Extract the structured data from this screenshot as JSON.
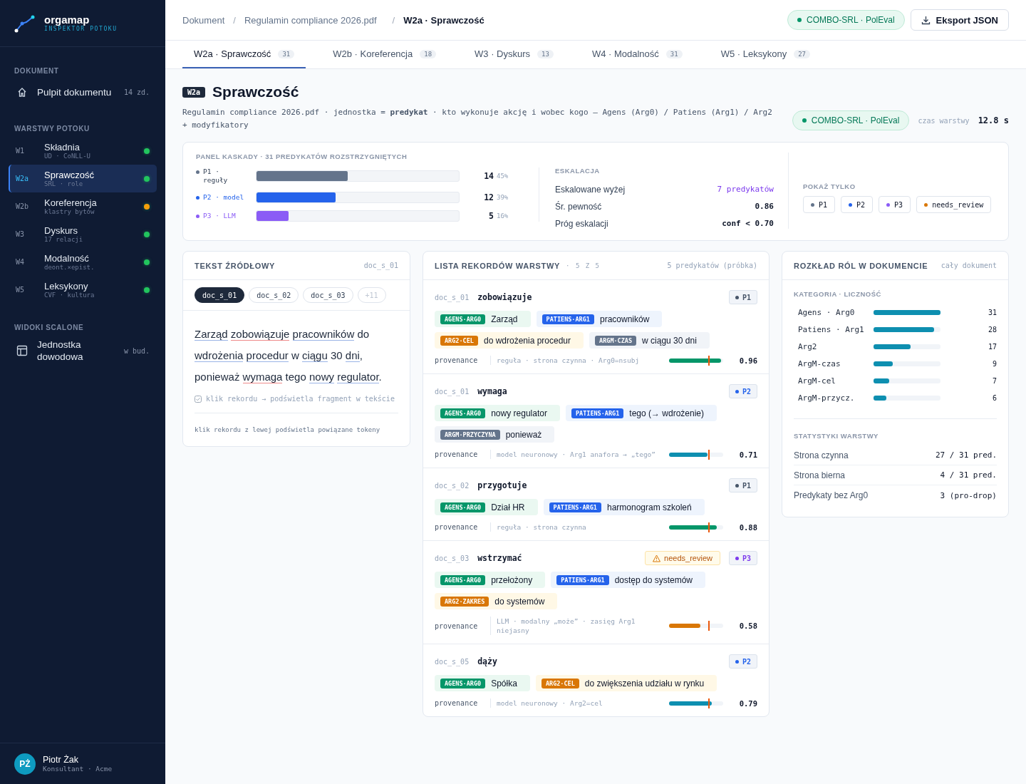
{
  "sidebar": {
    "logo": {
      "name": "orgamap",
      "tagline": "INSPEKTOR POTOKU"
    },
    "sections": [
      {
        "heading": "DOKUMENT",
        "items": [
          {
            "kind": "dashboard",
            "label": "Pulpit dokumentu",
            "meta": "14 zd.",
            "selected": false
          }
        ]
      },
      {
        "heading": "WARSTWY POTOKU",
        "items": [
          {
            "kind": "layer",
            "code": "W1",
            "label": "Składnia",
            "sub": "UD · CoNLL-U",
            "color": "#22c55e",
            "selected": false
          },
          {
            "kind": "layer",
            "code": "W2a",
            "label": "Sprawczość",
            "sub": "SRL · role",
            "color": "#22c55e",
            "selected": true
          },
          {
            "kind": "layer",
            "code": "W2b",
            "label": "Koreferencja",
            "sub": "klastry bytów",
            "color": "#f59e0b",
            "selected": false
          },
          {
            "kind": "layer",
            "code": "W3",
            "label": "Dyskurs",
            "sub": "17 relacji",
            "color": "#22c55e",
            "selected": false
          },
          {
            "kind": "layer",
            "code": "W4",
            "label": "Modalność",
            "sub": "deont.×epist.",
            "color": "#22c55e",
            "selected": false
          },
          {
            "kind": "layer",
            "code": "W5",
            "label": "Leksykony",
            "sub": "CVF · kultura",
            "color": "#22c55e",
            "selected": false
          }
        ]
      },
      {
        "heading": "WIDOKI SCALONE",
        "items": [
          {
            "kind": "view",
            "label": "Jednostka dowodowa",
            "meta": "w bud.",
            "selected": false
          }
        ]
      }
    ],
    "user": {
      "initials": "PŻ",
      "name": "Piotr Żak",
      "role": "Konsultant · Acme"
    }
  },
  "breadcrumb": {
    "separator": "/",
    "items": [
      "Dokument",
      "Regulamin compliance 2026.pdf",
      "W2a · Sprawczość"
    ]
  },
  "header_badge": "COMBO-SRL · PolEval",
  "export_button": "Eksport JSON",
  "tabs": [
    {
      "label": "W2a · Sprawczość",
      "count": "31",
      "selected": true
    },
    {
      "label": "W2b · Koreferencja",
      "count": "18",
      "selected": false
    },
    {
      "label": "W3 · Dyskurs",
      "count": "13",
      "selected": false
    },
    {
      "label": "W4 · Modalność",
      "count": "31",
      "selected": false
    },
    {
      "label": "W5 · Leksykony",
      "count": "27",
      "selected": false
    }
  ],
  "layer": {
    "code": "W2a",
    "title": "Sprawczość",
    "description": "Regulamin compliance 2026.pdf · jednostka = **predykat** · kto wykonuje akcję i wobec kogo — Agens (Arg0) / Patiens (Arg1) / Arg2 + modyfikatory",
    "badge": "COMBO-SRL · PolEval",
    "time_label": "czas warstwy",
    "time": "12.8 s"
  },
  "cascade": {
    "title": "PANEL KASKADY · 31 PREDYKATÓW ROZSTRZYGNIĘTYCH",
    "passes": [
      {
        "label": "P1 · reguły",
        "color": "#64748b",
        "level": 0.45,
        "count": "14",
        "percent": "45%"
      },
      {
        "label": "P2 · model",
        "color": "#2563eb",
        "level": 0.39,
        "count": "12",
        "percent": "39%"
      },
      {
        "label": "P3 · LLM",
        "color": "#8b5cf6",
        "level": 0.16,
        "count": "5",
        "percent": "16%"
      }
    ],
    "escalation": {
      "title": "ESKALACJA",
      "rows": [
        {
          "label": "Eskalowane wyżej",
          "value": "7 predykatów",
          "kind": "accent"
        },
        {
          "label": "Śr. pewność",
          "value": "0.86",
          "kind": "plain"
        },
        {
          "label": "Próg eskalacji",
          "value": "conf < 0.70",
          "kind": "plain"
        }
      ]
    },
    "filter": {
      "title": "POKAŻ TYLKO",
      "chips": [
        {
          "label": "P1",
          "color": "#64748b"
        },
        {
          "label": "P2",
          "color": "#2563eb"
        },
        {
          "label": "P3",
          "color": "#8b5cf6"
        },
        {
          "label": "needs_review",
          "color": "#d97706"
        }
      ]
    }
  },
  "source": {
    "title": "TEKST ŹRÓDŁOWY",
    "meta": "doc_s_01",
    "chips": [
      {
        "label": "doc_s_01",
        "kind": "doc",
        "selected": true
      },
      {
        "label": "doc_s_02",
        "kind": "doc",
        "selected": false
      },
      {
        "label": "doc_s_03",
        "kind": "doc",
        "selected": false
      },
      {
        "label": "+11",
        "kind": "more",
        "selected": false
      }
    ],
    "tokens": [
      {
        "text": "Zarząd",
        "kind": "arg"
      },
      {
        "text": "zobowiązuje",
        "kind": "pred"
      },
      {
        "text": "pracowników",
        "kind": "arg"
      },
      {
        "text": "do",
        "kind": "plain"
      },
      {
        "text": "wdrożenia",
        "kind": "arg"
      },
      {
        "text": "procedur",
        "kind": "arg"
      },
      {
        "text": "w",
        "kind": "plain"
      },
      {
        "text": "ciągu",
        "kind": "arg"
      },
      {
        "text": "30",
        "kind": "plain"
      },
      {
        "text": "dni",
        "kind": "arg"
      },
      {
        "text": ",",
        "kind": "punct"
      },
      {
        "text": "ponieważ",
        "kind": "plain"
      },
      {
        "text": "wymaga",
        "kind": "pred"
      },
      {
        "text": "tego",
        "kind": "plain"
      },
      {
        "text": "nowy",
        "kind": "arg"
      },
      {
        "text": "regulator",
        "kind": "arg"
      },
      {
        "text": ".",
        "kind": "punct"
      }
    ],
    "hint": "klik rekordu → podświetla fragment w tekście",
    "footer": "klik rekordu z lewej podświetla powiązane tokeny"
  },
  "records": {
    "title": "LISTA REKORDÓW WARSTWY",
    "count": "· 5 Z 5",
    "meta": "5 predykatów (próbka)",
    "threshold": {
      "level": 0.73
    },
    "items": [
      {
        "doc": "doc_s_01",
        "predicate": "zobowiązuje",
        "pass": {
          "label": "P1",
          "color": "#475569"
        },
        "roles": [
          {
            "kind": "agens",
            "tag": "AGENS·ARG0",
            "text": "Zarząd"
          },
          {
            "kind": "patiens",
            "tag": "PATIENS·ARG1",
            "text": "pracowników"
          },
          {
            "kind": "arg2",
            "tag": "ARG2·CEL",
            "text": "do wdrożenia procedur"
          },
          {
            "kind": "argm",
            "tag": "ARGM·CZAS",
            "text": "w ciągu 30 dni"
          }
        ],
        "provenance_label": "provenance",
        "provenance": "reguła · strona czynna · Arg0=nsubj",
        "confidence": {
          "level": 0.96,
          "color": "#059669",
          "value": "0.96"
        }
      },
      {
        "doc": "doc_s_01",
        "predicate": "wymaga",
        "pass": {
          "label": "P2",
          "color": "#2563eb"
        },
        "roles": [
          {
            "kind": "agens",
            "tag": "AGENS·ARG0",
            "text": "nowy regulator"
          },
          {
            "kind": "patiens",
            "tag": "PATIENS·ARG1",
            "text": "tego (→ wdrożenie)"
          },
          {
            "kind": "argm",
            "tag": "ARGM·PRZYCZYNA",
            "text": "ponieważ"
          }
        ],
        "provenance_label": "provenance",
        "provenance": "model neuronowy · Arg1 anafora → „tego”",
        "confidence": {
          "level": 0.71,
          "color": "#0e8fb0",
          "value": "0.71"
        }
      },
      {
        "doc": "doc_s_02",
        "predicate": "przygotuje",
        "pass": {
          "label": "P1",
          "color": "#475569"
        },
        "roles": [
          {
            "kind": "agens",
            "tag": "AGENS·ARG0",
            "text": "Dział HR"
          },
          {
            "kind": "patiens",
            "tag": "PATIENS·ARG1",
            "text": "harmonogram szkoleń"
          }
        ],
        "provenance_label": "provenance",
        "provenance": "reguła · strona czynna",
        "confidence": {
          "level": 0.88,
          "color": "#059669",
          "value": "0.88"
        }
      },
      {
        "doc": "doc_s_03",
        "predicate": "wstrzymać",
        "pass": {
          "label": "P3",
          "color": "#7c3aed"
        },
        "flag": "needs_review",
        "roles": [
          {
            "kind": "agens",
            "tag": "AGENS·ARG0",
            "text": "przełożony"
          },
          {
            "kind": "patiens",
            "tag": "PATIENS·ARG1",
            "text": "dostęp do systemów"
          },
          {
            "kind": "arg2",
            "tag": "ARG2·ZAKRES",
            "text": "do systemów"
          }
        ],
        "provenance_label": "provenance",
        "provenance": "LLM · modalny „może” · zasięg Arg1 niejasny",
        "confidence": {
          "level": 0.58,
          "color": "#d97706",
          "value": "0.58"
        }
      },
      {
        "doc": "doc_s_05",
        "predicate": "dąży",
        "pass": {
          "label": "P2",
          "color": "#2563eb"
        },
        "roles": [
          {
            "kind": "agens",
            "tag": "AGENS·ARG0",
            "text": "Spółka"
          },
          {
            "kind": "arg2",
            "tag": "ARG2·CEL",
            "text": "do zwiększenia udziału w rynku"
          }
        ],
        "provenance_label": "provenance",
        "provenance": "model neuronowy · Arg2=cel",
        "confidence": {
          "level": 0.79,
          "color": "#0e8fb0",
          "value": "0.79"
        }
      }
    ]
  },
  "roles": {
    "title": "ROZKŁAD RÓL W DOKUMENCIE",
    "meta": "cały dokument",
    "subtitle": "KATEGORIA · LICZNOŚĆ",
    "rows": [
      {
        "label": "Agens · Arg0",
        "level": 1.0,
        "count": "31"
      },
      {
        "label": "Patiens · Arg1",
        "level": 0.9,
        "count": "28"
      },
      {
        "label": "Arg2",
        "level": 0.55,
        "count": "17"
      },
      {
        "label": "ArgM-czas",
        "level": 0.29,
        "count": "9"
      },
      {
        "label": "ArgM-cel",
        "level": 0.23,
        "count": "7"
      },
      {
        "label": "ArgM-przycz.",
        "level": 0.19,
        "count": "6"
      }
    ],
    "stats_title": "STATYSTYKI WARSTWY",
    "stats": [
      {
        "label": "Strona czynna",
        "value": "27 / 31 pred."
      },
      {
        "label": "Strona bierna",
        "value": "4 / 31 pred."
      },
      {
        "label": "Predykaty bez Arg0",
        "value": "3 (pro-drop)"
      }
    ]
  }
}
